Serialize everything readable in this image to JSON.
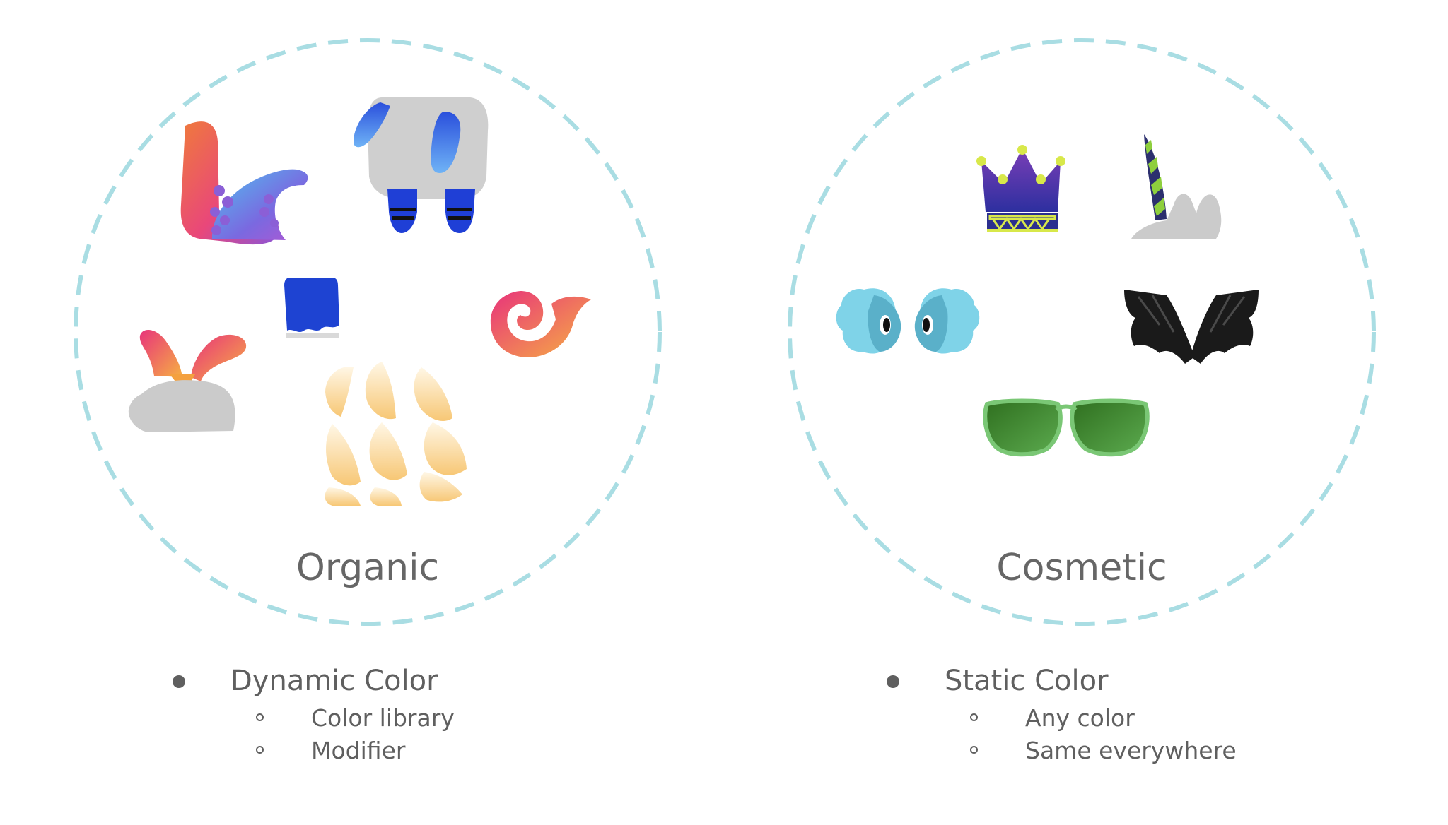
{
  "groups": [
    {
      "title": "Organic",
      "heading": "Dynamic Color",
      "items": [
        "Color library",
        "Modifier"
      ]
    },
    {
      "title": "Cosmetic",
      "heading": "Static Color",
      "items": [
        "Any color",
        "Same everywhere"
      ]
    }
  ],
  "colors": {
    "circle_outline": "#a9dde3",
    "text": "#5f5f5f"
  },
  "icons": {
    "organic": [
      "tentacle-icon",
      "elephant-ears-icon",
      "blue-cape-icon",
      "bunny-ears-icon",
      "spiral-tail-icon",
      "scales-icon"
    ],
    "cosmetic": [
      "crown-icon",
      "unicorn-horn-icon",
      "fish-eyes-icon",
      "bat-wings-icon",
      "sunglasses-icon"
    ]
  }
}
